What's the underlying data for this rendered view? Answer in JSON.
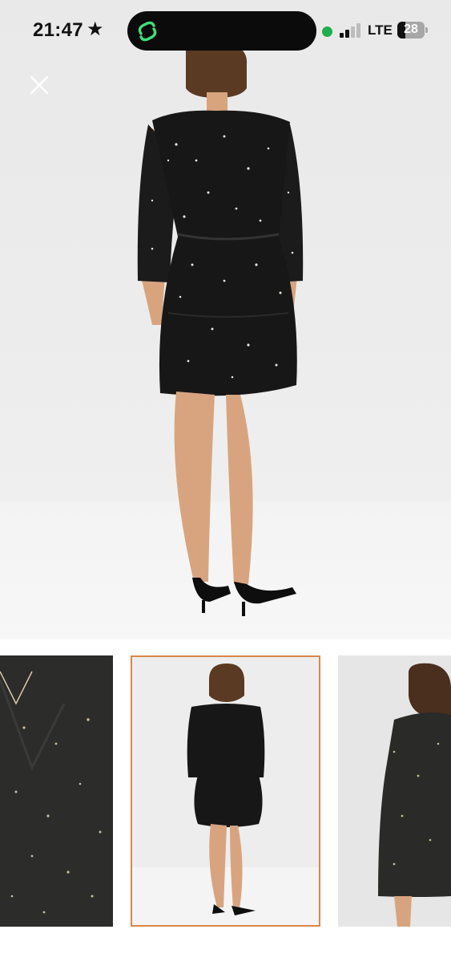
{
  "status_bar": {
    "time": "21:47",
    "star_icon": "★",
    "network": "LTE",
    "battery": "28"
  },
  "colors": {
    "accent_border": "#d9874a",
    "signal_dot": "#1fae4d",
    "app_icon": "#3de07a"
  },
  "viewer": {
    "close_icon": "close-icon",
    "selected_thumbnail_index": 1,
    "thumbnails": [
      {
        "name": "fabric-closeup"
      },
      {
        "name": "back-view-full"
      },
      {
        "name": "back-view-upper"
      }
    ]
  }
}
